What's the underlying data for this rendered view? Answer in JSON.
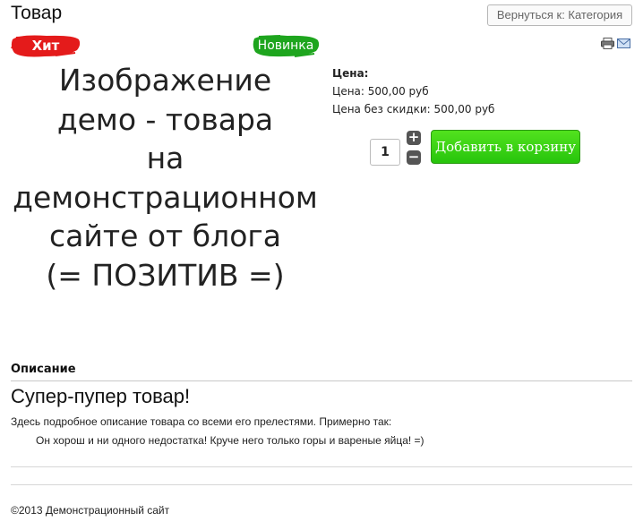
{
  "product": {
    "title": "Товар",
    "back_button": "Вернуться к: Категория",
    "icons": [
      "print-icon",
      "email-icon"
    ],
    "badges": {
      "hit": "Хит",
      "new": "Новинка"
    },
    "image_text_lines": [
      "Изображение",
      "демо - товара",
      "на",
      "демонстрационном",
      "сайте от блога",
      "(= ПОЗИТИВ =)"
    ]
  },
  "price": {
    "heading": "Цена:",
    "price_line": "Цена: 500,00 руб",
    "no_discount_line": "Цена без скидки: 500,00 руб"
  },
  "cart": {
    "quantity": "1",
    "plus": "+",
    "minus": "−",
    "add_button": "Добавить в корзину"
  },
  "description": {
    "heading": "Описание",
    "title": "Супер-пупер товар!",
    "text": "Здесь подробное описание товара со всеми его прелестями. Примерно так:",
    "quote": "Он хорош и ни одного недостатка! Круче него только горы и вареные яйца! =)"
  },
  "footer": {
    "copyright": "©2013 Демонстрационный сайт"
  },
  "colors": {
    "hit_badge": "#e01818",
    "new_badge": "#1aa01a",
    "cart_button": "#32cc14"
  }
}
